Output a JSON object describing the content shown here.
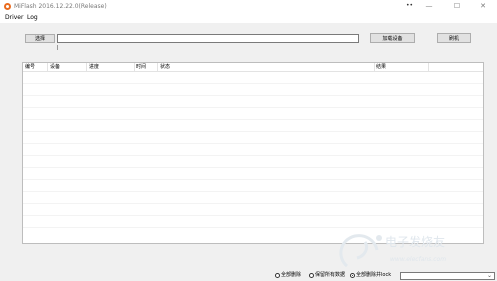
{
  "window": {
    "title": "MiFlash 2016.12.22.0(Release)",
    "dots": "••",
    "minimize": "—",
    "maximize": "☐",
    "close": "✕"
  },
  "menu": {
    "items": [
      "Driver",
      "Log"
    ]
  },
  "toolbar": {
    "select_label": "选择",
    "path_value": "",
    "load_device_label": "加载设备",
    "flash_label": "刷机"
  },
  "table": {
    "columns": [
      "编号",
      "设备",
      "进度",
      "时间",
      "状态",
      "结果"
    ],
    "rows": []
  },
  "bottom": {
    "options": [
      {
        "label": "全部删除",
        "selected": false
      },
      {
        "label": "保留所有数据",
        "selected": false
      },
      {
        "label": "全部删除并lock",
        "selected": true
      }
    ],
    "dropdown_value": "",
    "dropdown_icon": "chevron-down-icon"
  },
  "watermark": {
    "brand": "电子发烧友",
    "url": "www.elecfans.com"
  }
}
